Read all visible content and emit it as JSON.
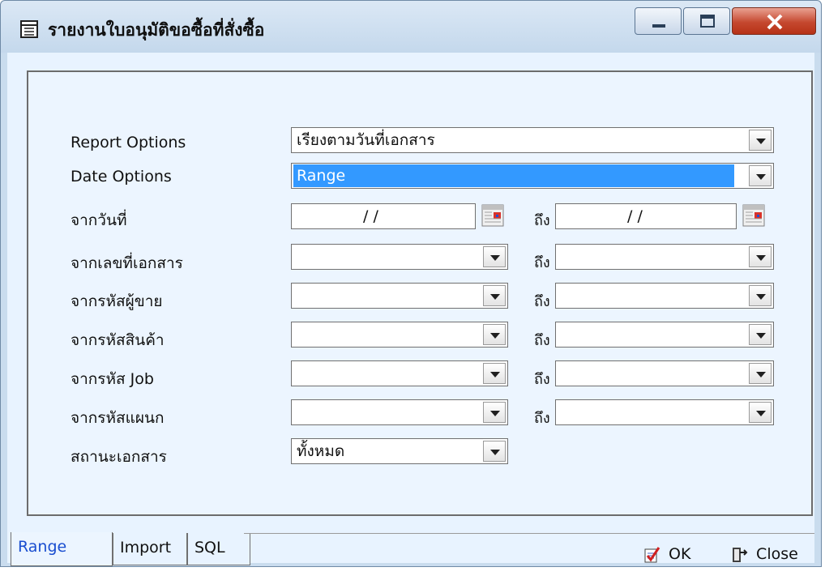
{
  "window": {
    "title": "รายงานใบอนุมัติขอซื้อที่สั่งซื้อ"
  },
  "form": {
    "report_options": {
      "label": "Report Options",
      "value": "เรียงตามวันที่เอกสาร"
    },
    "date_options": {
      "label": "Date Options",
      "value": "Range"
    },
    "date_range": {
      "label": "จากวันที่",
      "from": "/ /",
      "to_label": "ถึง",
      "to": "/ /"
    },
    "doc_no": {
      "label": "จากเลขที่เอกสาร",
      "to_label": "ถึง",
      "from": "",
      "to": ""
    },
    "seller_code": {
      "label": "จากรหัสผู้ขาย",
      "to_label": "ถึง",
      "from": "",
      "to": ""
    },
    "product_code": {
      "label": "จากรหัสสินค้า",
      "to_label": "ถึง",
      "from": "",
      "to": ""
    },
    "job_code": {
      "label": "จากรหัส Job",
      "to_label": "ถึง",
      "from": "",
      "to": ""
    },
    "dept_code": {
      "label": "จากรหัสแผนก",
      "to_label": "ถึง",
      "from": "",
      "to": ""
    },
    "doc_status": {
      "label": "สถานะเอกสาร",
      "value": "ทั้งหมด"
    }
  },
  "tabs": [
    {
      "label": "Range",
      "active": true
    },
    {
      "label": "Import",
      "active": false
    },
    {
      "label": "SQL",
      "active": false
    }
  ],
  "buttons": {
    "ok": "OK",
    "close": "Close"
  },
  "colors": {
    "selection": "#3399ff",
    "active_tab": "#1a4ed0",
    "close_button": "#c5482f"
  }
}
